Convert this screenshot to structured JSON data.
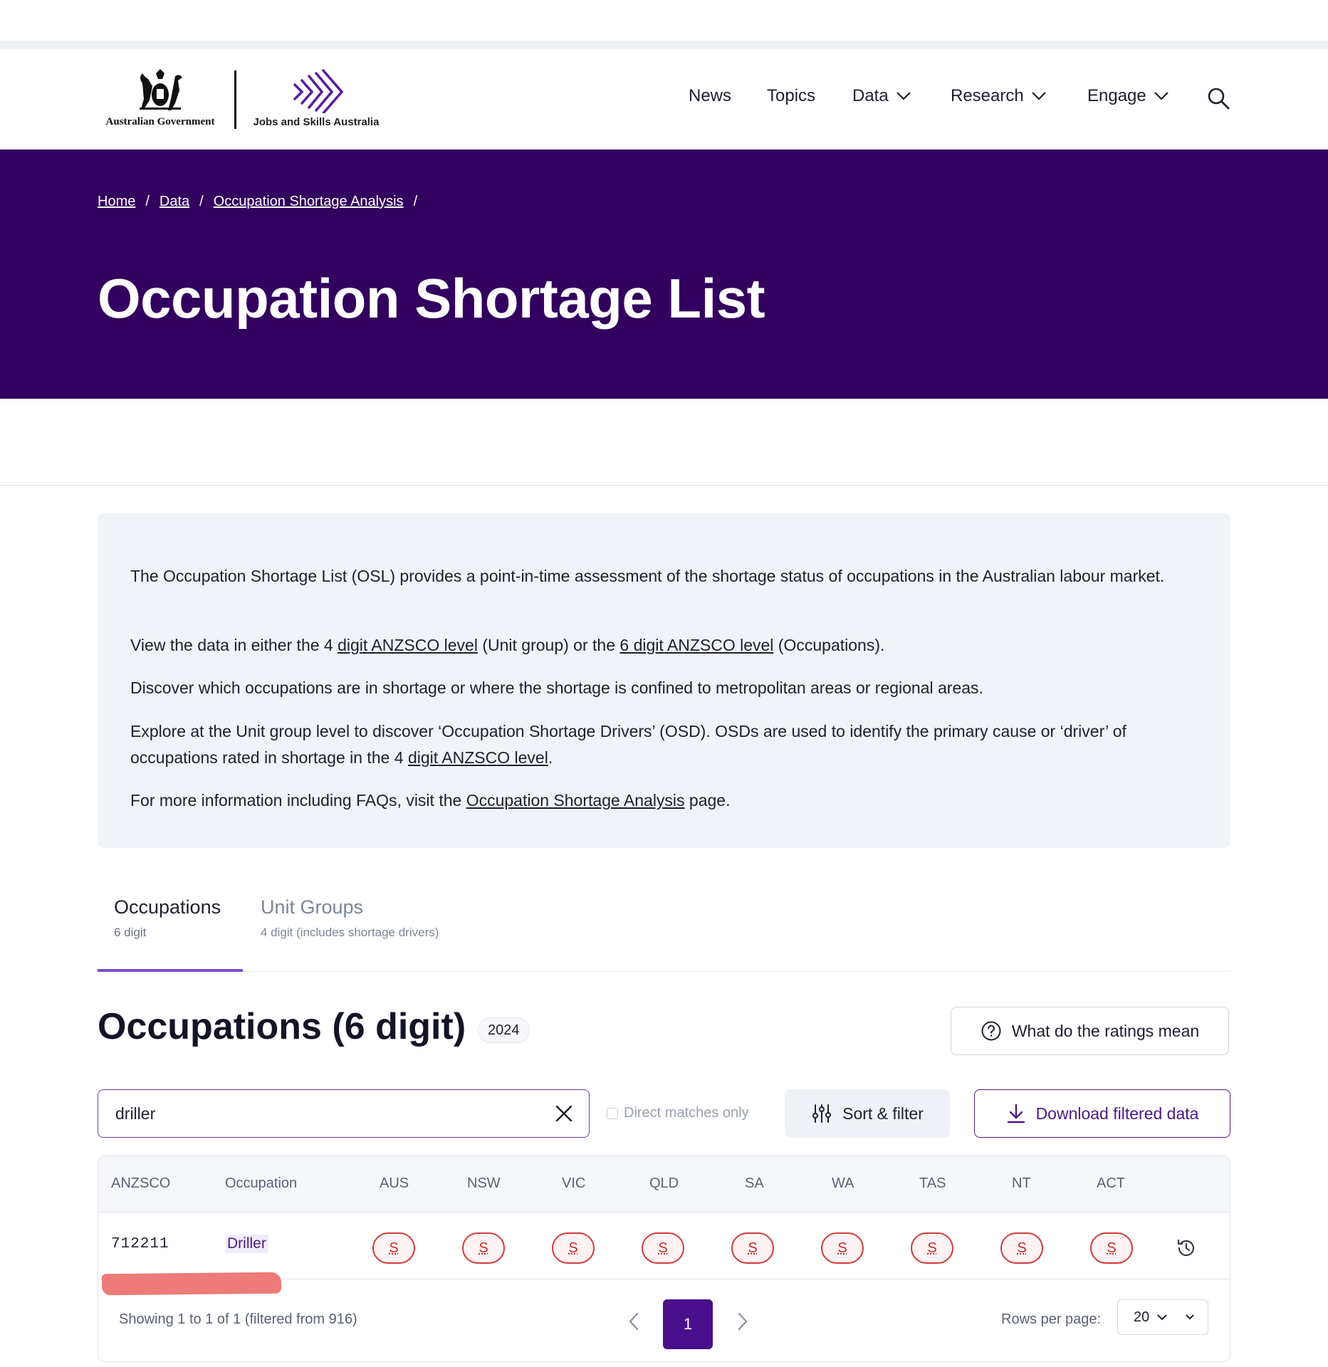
{
  "header": {
    "gov_logo_text": "Australian Government",
    "jsa_logo_text": "Jobs and Skills Australia",
    "nav": [
      {
        "label": "News"
      },
      {
        "label": "Topics"
      },
      {
        "label": "Data"
      },
      {
        "label": "Research"
      },
      {
        "label": "Engage"
      }
    ]
  },
  "breadcrumb": [
    "Home",
    "Data",
    "Occupation Shortage Analysis"
  ],
  "breadcrumb_sep": "/",
  "page_title": "Occupation Shortage List",
  "intro": {
    "p1": "The Occupation Shortage List (OSL) provides a point-in-time assessment of the shortage status of occupations in the Australian labour market.",
    "p2_a": "View the data in either the 4 ",
    "p2_link1": "digit ANZSCO level",
    "p2_b": " (Unit group) or the ",
    "p2_link2": "6 digit ANZSCO level",
    "p2_c": " (Occupations).",
    "p3": "Discover which occupations are in shortage or where the shortage is confined to metropolitan areas or regional areas.",
    "p4_a": "Explore at the Unit group level to discover ‘Occupation Shortage Drivers’ (OSD). OSDs are used to identify the primary cause or ‘driver’ of occupations rated in shortage in the 4 ",
    "p4_link": "digit ANZSCO level",
    "p4_b": ".",
    "p5_a": "For more information including FAQs, visit the ",
    "p5_link": "Occupation Shortage Analysis",
    "p5_b": " page."
  },
  "tabs": [
    {
      "label": "Occupations",
      "sub": "6 digit"
    },
    {
      "label": "Unit Groups",
      "sub": "4 digit (includes shortage drivers)"
    }
  ],
  "section": {
    "title": "Occupations (6 digit)",
    "year": "2024",
    "ratings_button": "What do the ratings mean"
  },
  "controls": {
    "search_value": "driller",
    "direct_matches_label": "Direct matches only",
    "sort_filter_label": "Sort & filter",
    "download_label": "Download filtered data"
  },
  "table": {
    "headers": [
      "ANZSCO",
      "Occupation",
      "AUS",
      "NSW",
      "VIC",
      "QLD",
      "SA",
      "WA",
      "TAS",
      "NT",
      "ACT"
    ],
    "rows": [
      {
        "anzsco": "712211",
        "occupation": "Driller",
        "ratings": [
          "S",
          "S",
          "S",
          "S",
          "S",
          "S",
          "S",
          "S",
          "S"
        ]
      }
    ]
  },
  "footer": {
    "showing": "Showing 1 to 1 of 1 (filtered from 916)",
    "current_page": "1",
    "rows_per_page_label": "Rows per page:",
    "rows_per_page_value": "20"
  },
  "colors": {
    "hero_bg": "#32005e",
    "accent": "#4a0f8c",
    "shortage_red": "#d23a3a"
  },
  "icons": {
    "search": "search-icon",
    "chevron": "chevron-down-icon",
    "help": "help-circle-icon",
    "sliders": "sliders-icon",
    "download": "download-icon",
    "close": "close-icon",
    "history": "history-icon"
  }
}
